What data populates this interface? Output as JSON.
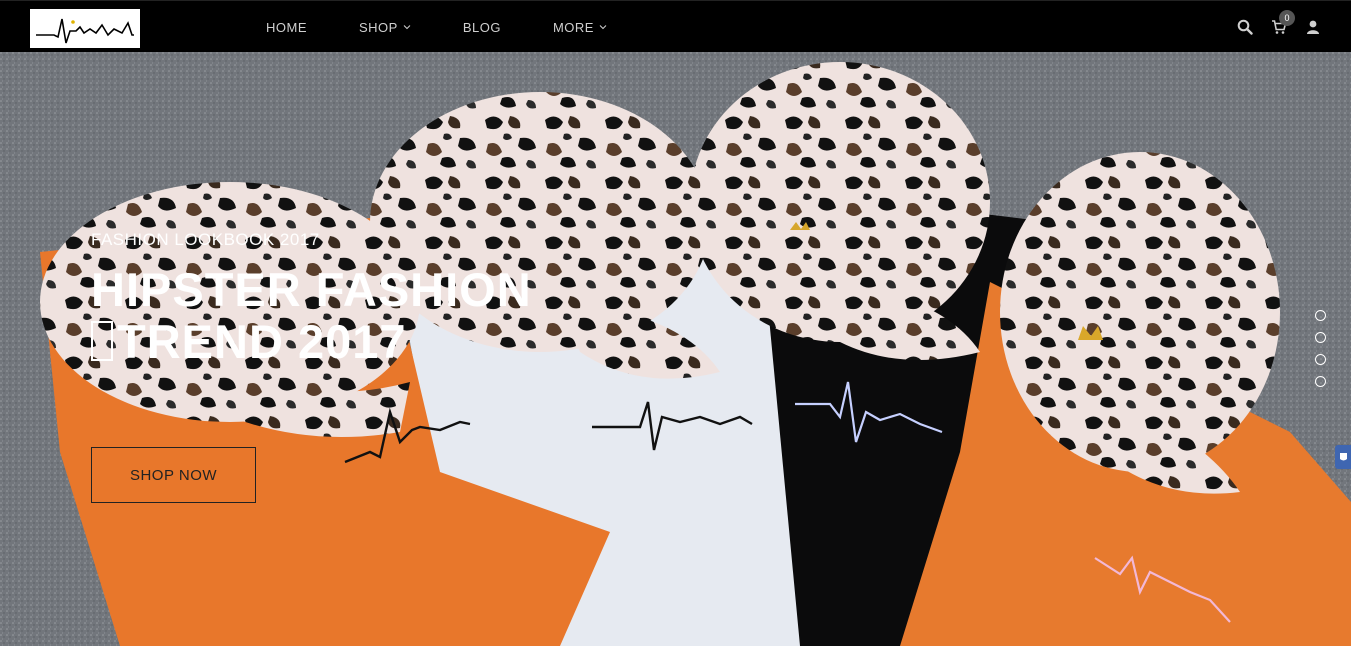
{
  "brand": {
    "logo_icon": "heartbeat-signature-logo"
  },
  "nav": {
    "items": [
      {
        "label": "HOME",
        "has_dropdown": false
      },
      {
        "label": "SHOP",
        "has_dropdown": true
      },
      {
        "label": "BLOG",
        "has_dropdown": false
      },
      {
        "label": "MORE",
        "has_dropdown": true
      }
    ]
  },
  "header_icons": {
    "search_icon": "search-icon",
    "cart_icon": "cart-icon",
    "cart_count": "0",
    "account_icon": "user-icon"
  },
  "hero": {
    "subtitle": "FASHION LOOKBOOK 2017",
    "title_line1": "HIPSTER FASHION",
    "title_line2": "TREND 2017",
    "cta_label": "SHOP NOW",
    "slides_count": 4
  },
  "colors": {
    "nav_bg": "#000000",
    "nav_text": "#cfcfcf",
    "hero_text": "#ffffff",
    "orange_shirt": "#e8772b",
    "side_tab": "#3f66b1"
  }
}
